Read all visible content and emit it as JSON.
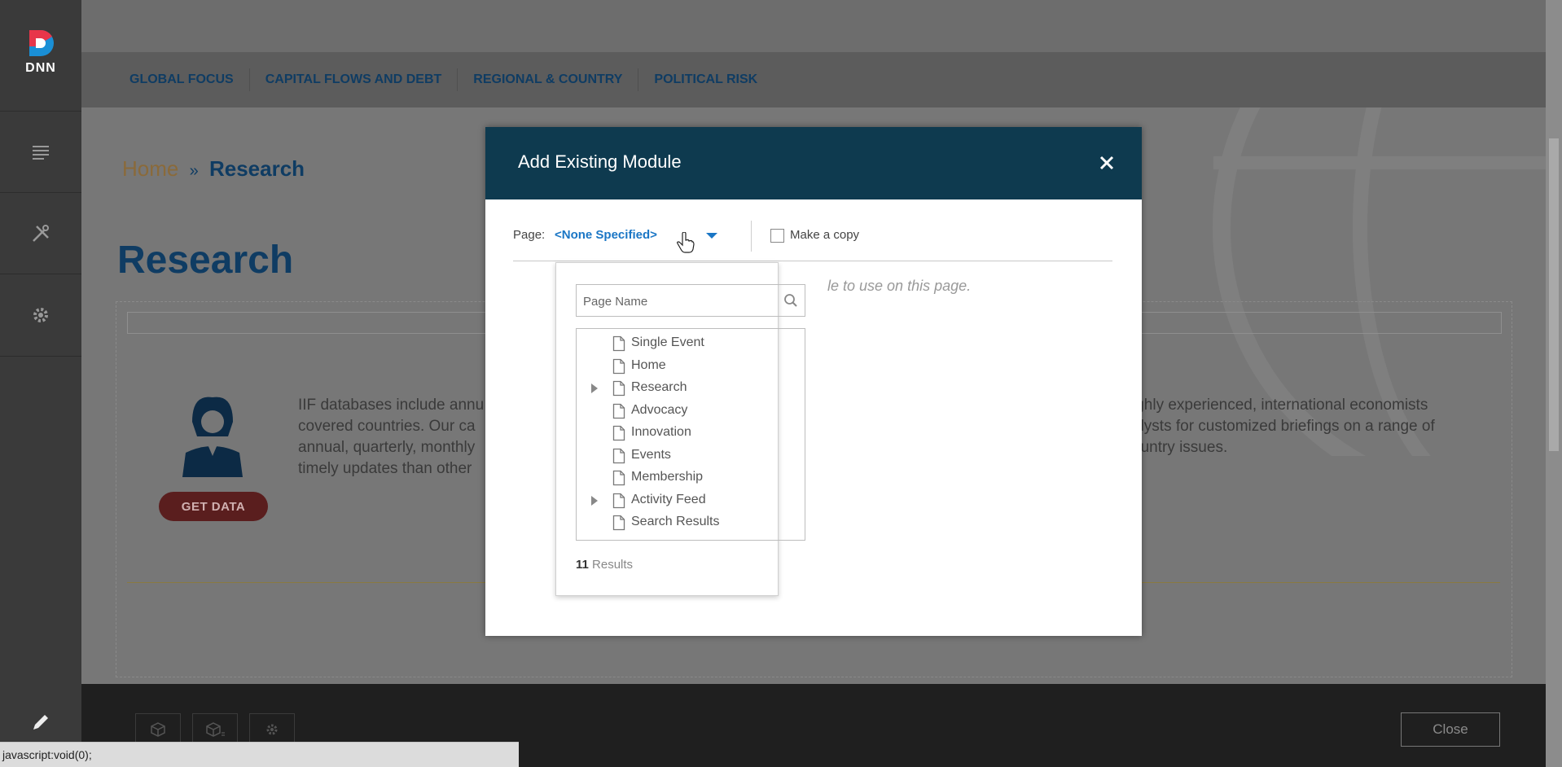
{
  "persona_bar": {
    "logo_text": "DNN",
    "items": [
      "content-icon",
      "tools-icon",
      "settings-icon"
    ],
    "edit_icon": "pencil-icon"
  },
  "site": {
    "nav": [
      "GLOBAL FOCUS",
      "CAPITAL FLOWS AND DEBT",
      "REGIONAL & COUNTRY",
      "POLITICAL RISK"
    ],
    "breadcrumb": {
      "home": "Home",
      "separator": "»",
      "current": "Research"
    },
    "title": "Research",
    "get_data": "GET DATA",
    "left_text": [
      "IIF databases include annu",
      "covered countries. Our ca",
      "annual, quarterly, monthly",
      "timely updates than other"
    ],
    "right_text": [
      "ighly experienced, international economists",
      "alysts for customized briefings on a range of",
      "ountry issues."
    ],
    "close": "Close"
  },
  "modal": {
    "title": "Add Existing Module",
    "close_icon": "close-icon",
    "page_label": "Page:",
    "page_selected": "<None Specified>",
    "make_copy_label": "Make a copy",
    "make_copy_checked": false,
    "hint": "le to use on this page."
  },
  "dropdown": {
    "search_placeholder": "Page Name",
    "items": [
      {
        "label": "Single Event",
        "expandable": false
      },
      {
        "label": "Home",
        "expandable": false
      },
      {
        "label": "Research",
        "expandable": true
      },
      {
        "label": "Advocacy",
        "expandable": false
      },
      {
        "label": "Innovation",
        "expandable": false
      },
      {
        "label": "Events",
        "expandable": false
      },
      {
        "label": "Membership",
        "expandable": false
      },
      {
        "label": "Activity Feed",
        "expandable": true
      },
      {
        "label": "Search Results",
        "expandable": false
      }
    ],
    "results_count": "11",
    "results_label": "Results"
  },
  "status_bar": "javascript:void(0);",
  "colors": {
    "modal_header": "#0e3a4f",
    "link_blue": "#1a76c5",
    "nav_text": "#0f3c63"
  }
}
